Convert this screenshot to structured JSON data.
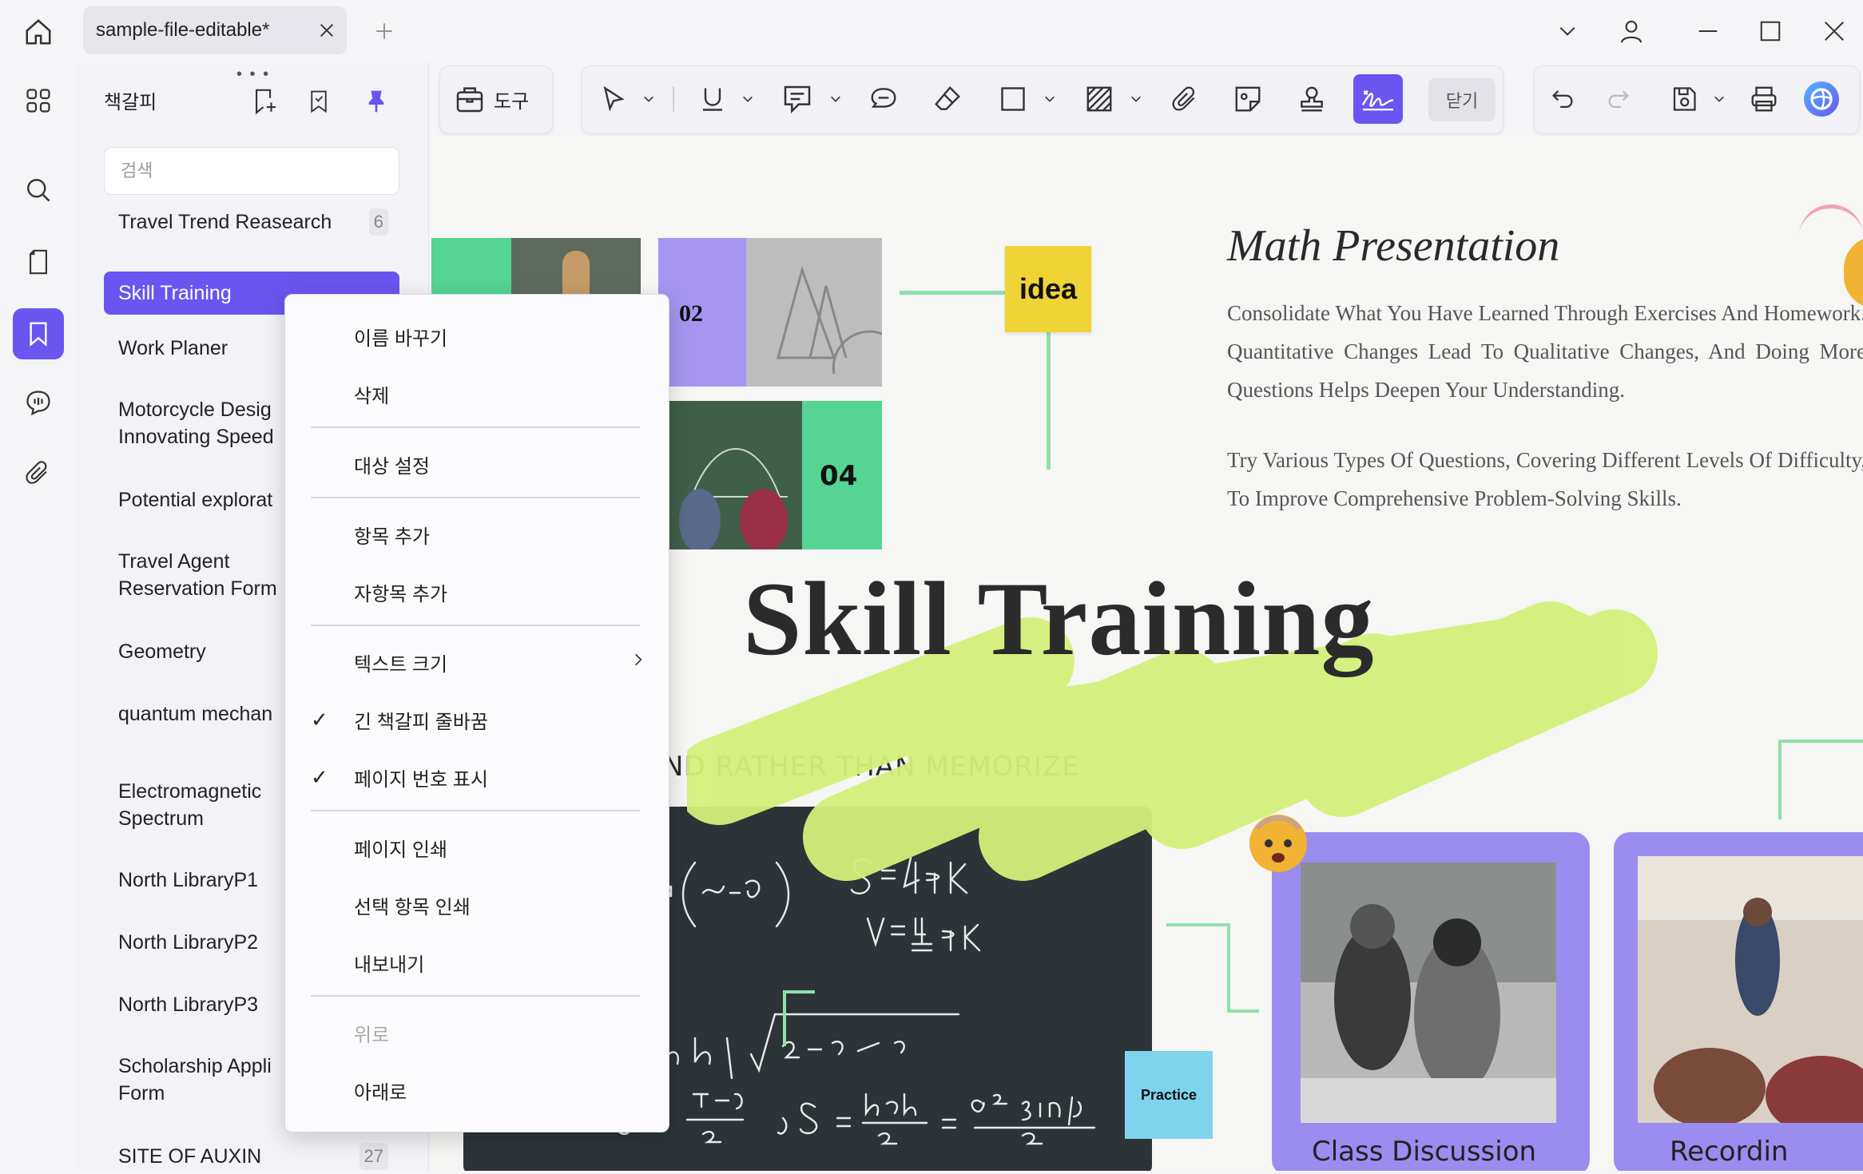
{
  "window": {
    "tab_title": "sample-file-editable*"
  },
  "panel": {
    "title": "책갈피",
    "search_placeholder": "검색",
    "bookmarks": [
      {
        "label": "Travel Trend Reasearch",
        "count": "6"
      },
      {
        "label": "Skill Training",
        "count": ""
      },
      {
        "label": "Work Planer",
        "count": ""
      },
      {
        "label": "Motorcycle Desig",
        "label2": "Innovating Speed",
        "count": ""
      },
      {
        "label": "Potential explorat",
        "count": ""
      },
      {
        "label": "Travel Agent",
        "label2": "Reservation Form",
        "count": ""
      },
      {
        "label": "Geometry",
        "count": ""
      },
      {
        "label": "quantum mechan",
        "count": ""
      },
      {
        "label": "Electromagnetic",
        "label2": "Spectrum",
        "count": ""
      },
      {
        "label": "North LibraryP1",
        "count": ""
      },
      {
        "label": "North LibraryP2",
        "count": ""
      },
      {
        "label": "North LibraryP3",
        "count": ""
      },
      {
        "label": "Scholarship Appli",
        "label2": "Form",
        "count": ""
      },
      {
        "label": "SITE OF AUXIN",
        "count": "27"
      }
    ]
  },
  "context_menu": {
    "items": [
      {
        "label": "이름 바꾸기"
      },
      {
        "label": "삭제"
      },
      {
        "label": "대상 설정"
      },
      {
        "label": "항목 추가"
      },
      {
        "label": "자항목 추가"
      },
      {
        "label": "텍스트 크기",
        "submenu": true
      },
      {
        "label": "긴 책갈피 줄바꿈",
        "checked": true
      },
      {
        "label": "페이지 번호 표시",
        "checked": true
      },
      {
        "label": "페이지 인쇄"
      },
      {
        "label": "선택 항목 인쇄"
      },
      {
        "label": "내보내기"
      },
      {
        "label": "위로",
        "disabled": true
      },
      {
        "label": "아래로"
      }
    ],
    "check_glyph": "✓"
  },
  "toolbar": {
    "tools_label": "도구",
    "close_label": "닫기"
  },
  "document": {
    "math_title": "Math Presentation",
    "math_para1": "Consolidate What You Have Learned Through Exercises And Homework. Quantitative Changes Lead To Qualitative Changes, And Doing More Questions Helps Deepen Your Understanding.",
    "math_para2": "Try Various Types Of Questions, Covering Different Levels Of Difficulty, To Improve Comprehensive Problem-Solving Skills.",
    "skill_title": "Skill Training",
    "tagline": "ND RATHER THAN MEMORIZE",
    "idea_note": "idea",
    "practice_note": "Practice",
    "num_02": "02",
    "num_04": "04",
    "caption1": "Class Discussion",
    "caption2": "Recordin"
  },
  "colors": {
    "accent": "#6a55f0",
    "highlighter": "#d4f07a",
    "card": "#9b8cf0",
    "teal": "#55d494",
    "sticky_yellow": "#f0d335",
    "sticky_blue": "#7ed4ec"
  }
}
